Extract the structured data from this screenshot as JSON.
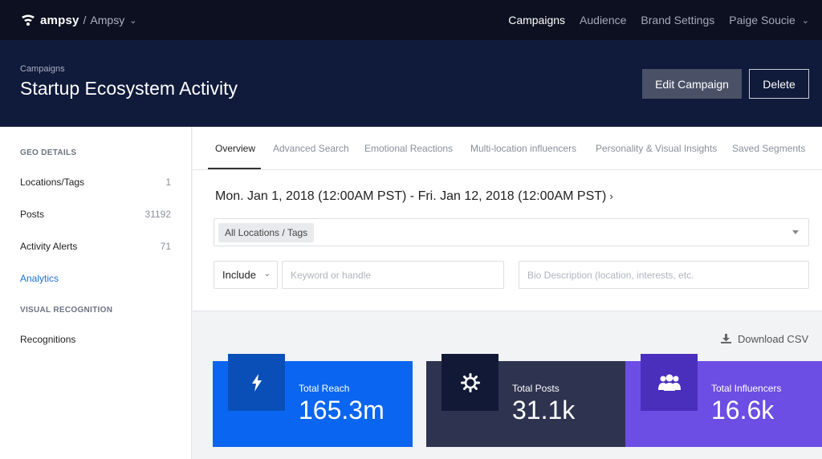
{
  "topnav": {
    "brand": "ampsy",
    "separator": "/",
    "org": "Ampsy",
    "links": [
      "Campaigns",
      "Audience",
      "Brand Settings",
      "Paige Soucie"
    ]
  },
  "header": {
    "breadcrumb": "Campaigns",
    "title": "Startup Ecosystem Activity",
    "edit_label": "Edit Campaign",
    "delete_label": "Delete"
  },
  "sidebar": {
    "geo_heading": "GEO DETAILS",
    "items": [
      {
        "label": "Locations/Tags",
        "count": "1"
      },
      {
        "label": "Posts",
        "count": "31192"
      },
      {
        "label": "Activity Alerts",
        "count": "71"
      },
      {
        "label": "Analytics",
        "count": ""
      }
    ],
    "visual_heading": "VISUAL RECOGNITION",
    "visual_items": [
      {
        "label": "Recognitions"
      }
    ]
  },
  "tabs": [
    "Overview",
    "Advanced Search",
    "Emotional Reactions",
    "Multi-location influencers",
    "Personality & Visual Insights",
    "Saved Segments"
  ],
  "filters": {
    "date_range": "Mon. Jan 1, 2018 (12:00AM PST) - Fri. Jan 12, 2018 (12:00AM PST)",
    "location_pill": "All Locations / Tags",
    "include_label": "Include",
    "keyword_placeholder": "Keyword or handle",
    "bio_placeholder": "Bio Description (location, interests, etc."
  },
  "download_label": "Download CSV",
  "stats": [
    {
      "label": "Total Reach",
      "value": "165.3m",
      "icon": "lightning-icon",
      "color": "#0a66f0",
      "icon_bg": "#0a4fb8"
    },
    {
      "label": "Total Posts",
      "value": "31.1k",
      "icon": "gear-icon",
      "color": "#2e3350",
      "icon_bg": "#121936"
    },
    {
      "label": "Total Influencers",
      "value": "16.6k",
      "icon": "users-icon",
      "color": "#6c4ee4",
      "icon_bg": "#4a2fbd"
    }
  ]
}
